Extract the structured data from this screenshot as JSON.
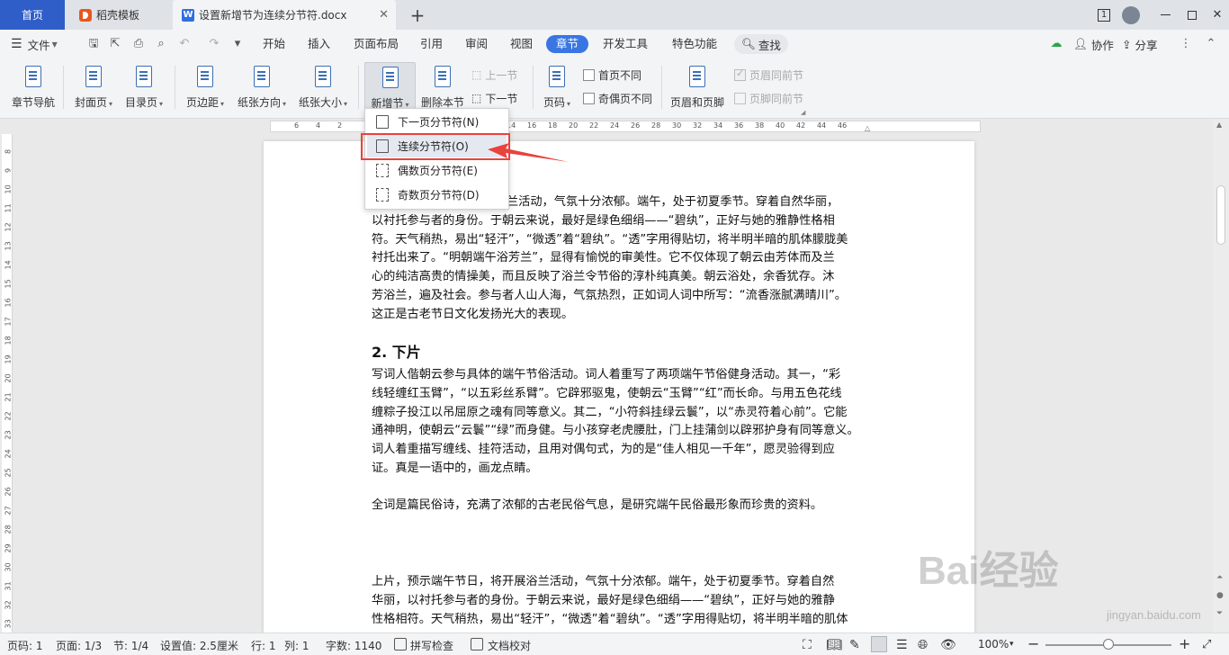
{
  "tabs": {
    "home": "首页",
    "templates": "稻壳模板",
    "document": "设置新增节为连续分节符.docx",
    "close": "✕",
    "add": "+"
  },
  "window": {
    "badge": "1"
  },
  "menubar": {
    "file": "文件",
    "tabs": [
      "开始",
      "插入",
      "页面布局",
      "引用",
      "审阅",
      "视图",
      "章节",
      "开发工具",
      "特色功能"
    ],
    "active_tab": "章节",
    "search": "查找",
    "collab": "协作",
    "share": "分享"
  },
  "ribbon": {
    "chapter_nav": "章节导航",
    "cover": "封面页",
    "toc": "目录页",
    "margin": "页边距",
    "orientation": "纸张方向",
    "size": "纸张大小",
    "new_section": "新增节",
    "delete_section": "删除本节",
    "prev_section": "上一节",
    "next_section": "下一节",
    "page_number": "页码",
    "first_page_diff": "首页不同",
    "odd_even_diff": "奇偶页不同",
    "header_footer": "页眉和页脚",
    "header_same": "页眉同前节",
    "footer_same": "页脚同前节"
  },
  "ruler": {
    "h_ticks": [
      "6",
      "4",
      "2",
      "2",
      "4",
      "6",
      "8",
      "10",
      "12",
      "14",
      "16",
      "18",
      "20",
      "22",
      "24",
      "26",
      "28",
      "30",
      "32",
      "34",
      "36",
      "38",
      "40",
      "42",
      "44",
      "46"
    ],
    "v_ticks": [
      "8",
      "9",
      "10",
      "11",
      "12",
      "13",
      "14",
      "15",
      "16",
      "17",
      "18",
      "19",
      "20",
      "21",
      "22",
      "23",
      "24",
      "25",
      "26",
      "27",
      "28",
      "29",
      "30",
      "31",
      "32",
      "33"
    ]
  },
  "dropdown": {
    "items": [
      "下一页分节符(N)",
      "连续分节符(O)",
      "偶数页分节符(E)",
      "奇数页分节符(D)"
    ],
    "highlighted": "连续分节符(O)"
  },
  "document": {
    "para1_lines": [
      "兰活动，气氛十分浓郁。端午，处于初夏季节。穿着自然华丽，",
      "以衬托参与者的身份。于朝云来说，最好是绿色细绢——“碧纨”，正好与她的雅静性格相",
      "符。天气稍热，易出“轻汗”，“微透”着“碧纨”。“透”字用得贴切，将半明半暗的肌体朦胧美",
      "衬托出来了。“明朝端午浴芳兰”，显得有愉悦的审美性。它不仅体现了朝云由芳体而及兰",
      "心的纯洁高贵的情操美，而且反映了浴兰令节俗的淳朴纯真美。朝云浴处，余香犹存。沐",
      "芳浴兰，遍及社会。参与者人山人海，气氛热烈，正如词人词中所写：“流香涨腻满晴川”。",
      "这正是古老节日文化发扬光大的表现。"
    ],
    "heading": "2.  下片",
    "para2_lines": [
      "写词人偕朝云参与具体的端午节俗活动。词人着重写了两项端午节俗健身活动。其一，“彩",
      "线轻缠红玉臂”，“以五彩丝系臂”。它辟邪驱鬼，使朝云“玉臂”“红”而长命。与用五色花线",
      "缠粽子投江以吊屈原之魂有同等意义。其二，“小符斜挂绿云鬟”，以“赤灵符着心前”。它能",
      "通神明，使朝云“云鬟”“绿”而身健。与小孩穿老虎腰肚，门上挂蒲剑以辟邪护身有同等意义。",
      "词人着重描写缠线、挂符活动，且用对偶句式，为的是“佳人相见一千年”，愿灵验得到应",
      "证。真是一语中的，画龙点睛。"
    ],
    "para3": "全词是篇民俗诗，充满了浓郁的古老民俗气息，是研究端午民俗最形象而珍贵的资料。",
    "para4_lines": [
      "上片，预示端午节日，将开展浴兰活动，气氛十分浓郁。端午，处于初夏季节。穿着自然",
      "华丽，以衬托参与者的身份。于朝云来说，最好是绿色细绢——“碧纨”，正好与她的雅静",
      "性格相符。天气稍热，易出“轻汗”，“微透”着“碧纨”。“透”字用得贴切，将半明半暗的肌体"
    ]
  },
  "status": {
    "page_num": "页码: 1",
    "page_of": "页面: 1/3",
    "section": "节: 1/4",
    "setting": "设置值: 2.5厘米",
    "row": "行: 1",
    "col": "列: 1",
    "word_count": "字数: 1140",
    "spellcheck": "拼写检查",
    "proofread": "文档校对",
    "zoom": "100%",
    "zoom_level_percent": 100
  },
  "watermark": {
    "brand": "Bai经验",
    "url": "jingyan.baidu.com"
  },
  "colors": {
    "accent": "#3a76e2",
    "home_tab": "#2f5ec8",
    "highlight_box": "#e8433f"
  }
}
